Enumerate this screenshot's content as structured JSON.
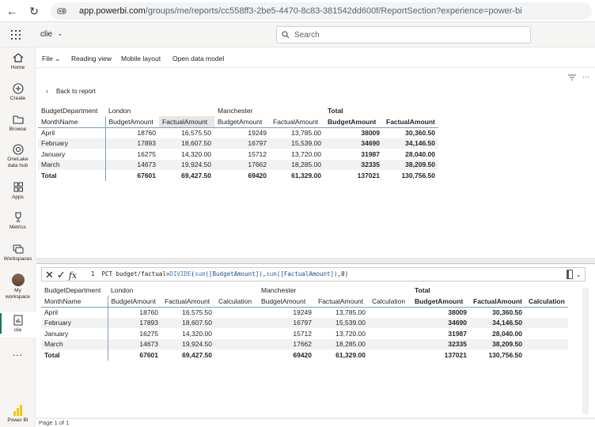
{
  "browser": {
    "url_domain": "app.powerbi.com",
    "url_path": "/groups/me/reports/cc558ff3-2be5-4470-8c83-381542dd600f/ReportSection?experience=power-bi"
  },
  "header": {
    "workspace": "clie",
    "search_placeholder": "Search"
  },
  "rail": {
    "items": [
      {
        "label": "Home",
        "icon": "home-icon"
      },
      {
        "label": "Create",
        "icon": "plus-circle-icon"
      },
      {
        "label": "Browse",
        "icon": "folder-icon"
      },
      {
        "label": "OneLake",
        "label2": "data hub",
        "icon": "onelake-icon"
      },
      {
        "label": "Apps",
        "icon": "apps-icon"
      },
      {
        "label": "Metrics",
        "icon": "trophy-icon"
      },
      {
        "label": "Workspaces",
        "icon": "workspaces-icon"
      },
      {
        "label": "My",
        "label2": "workspace",
        "icon": "avatar"
      },
      {
        "label": "clie",
        "icon": "report-icon"
      }
    ],
    "more": "...",
    "brand": "Power BI"
  },
  "toolbar": {
    "file": "File",
    "reading_view": "Reading view",
    "mobile_layout": "Mobile layout",
    "open_data_model": "Open data model"
  },
  "report": {
    "back_label": "Back to report",
    "page_label": "Page 1 of 1"
  },
  "formula": {
    "line_no": "1",
    "measure": "PCT budget/factual=",
    "func1": "DIVIDE",
    "part_a": "(",
    "func2": "sum",
    "field1": "([BudgetAmount])",
    "comma": ",",
    "func3": "sum",
    "field2": "([FactualAmount])",
    "tail": ",0)"
  },
  "matrix_top": {
    "row_header_1": "BudgetDepartment",
    "row_header_2": "MonthName",
    "groups": [
      "London",
      "Manchester",
      "Total"
    ],
    "cols": [
      "BudgetAmount",
      "FactualAmount"
    ],
    "rows": [
      {
        "name": "April",
        "v": [
          "18760",
          "16,575.50",
          "19249",
          "13,785.00",
          "38009",
          "30,360.50"
        ]
      },
      {
        "name": "February",
        "v": [
          "17893",
          "18,607.50",
          "16797",
          "15,539.00",
          "34690",
          "34,146.50"
        ]
      },
      {
        "name": "January",
        "v": [
          "16275",
          "14,320.00",
          "15712",
          "13,720.00",
          "31987",
          "28,040.00"
        ]
      },
      {
        "name": "March",
        "v": [
          "14673",
          "19,924.50",
          "17662",
          "18,285.00",
          "32335",
          "38,209.50"
        ]
      }
    ],
    "total": {
      "name": "Total",
      "v": [
        "67601",
        "69,427.50",
        "69420",
        "61,329.00",
        "137021",
        "130,756.50"
      ]
    }
  },
  "matrix_bottom": {
    "row_header_1": "BudgetDepartment",
    "row_header_2": "MonthName",
    "groups": [
      "London",
      "Manchester",
      "Total"
    ],
    "cols": [
      "BudgetAmount",
      "FactualAmount",
      "Calculation"
    ],
    "rows": [
      {
        "name": "April",
        "v": [
          "18760",
          "16,575.50",
          "",
          "19249",
          "13,785.00",
          "",
          "38009",
          "30,360.50",
          ""
        ]
      },
      {
        "name": "February",
        "v": [
          "17893",
          "18,607.50",
          "",
          "16797",
          "15,539.00",
          "",
          "34690",
          "34,146.50",
          ""
        ]
      },
      {
        "name": "January",
        "v": [
          "16275",
          "14,320.00",
          "",
          "15712",
          "13,720.00",
          "",
          "31987",
          "28,040.00",
          ""
        ]
      },
      {
        "name": "March",
        "v": [
          "14673",
          "19,924.50",
          "",
          "17662",
          "18,285.00",
          "",
          "32335",
          "38,209.50",
          ""
        ]
      }
    ],
    "total": {
      "name": "Total",
      "v": [
        "67601",
        "69,427.50",
        "",
        "69420",
        "61,329.00",
        "",
        "137021",
        "130,756.50",
        ""
      ]
    }
  }
}
